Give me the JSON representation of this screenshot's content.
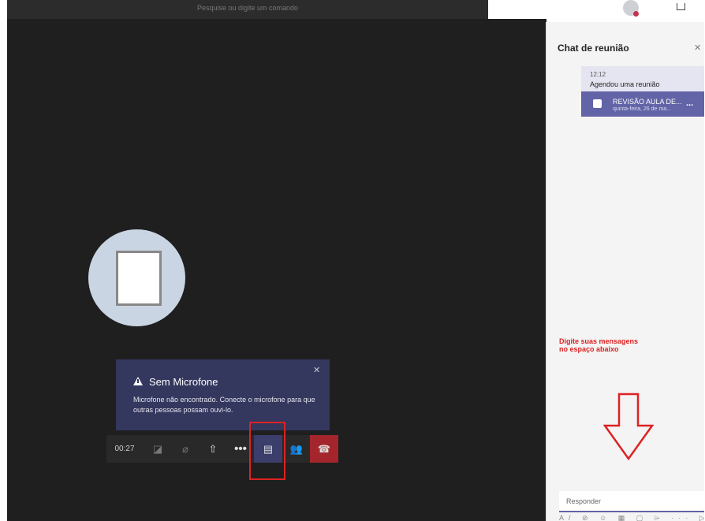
{
  "search": {
    "placeholder": "Pesquise ou digite um comando"
  },
  "toast": {
    "title": "Sem Microfone",
    "body": "Microfone não encontrado. Conecte o microfone para que outras pessoas possam ouvi-lo.",
    "close_glyph": "✕"
  },
  "callbar": {
    "timer": "00:27",
    "icons": [
      "video-off-icon",
      "mic-off-icon",
      "share-screen-icon",
      "more-icon",
      "chat-icon",
      "people-icon",
      "hangup-icon"
    ],
    "glyphs": {
      "camera": "◪",
      "mic": "⌀",
      "share": "⇧",
      "more": "•••",
      "chat": "▤",
      "people": "👥",
      "hangup": "☎"
    }
  },
  "panel": {
    "title": "Chat de reunião",
    "close_glyph": "✕",
    "message": {
      "time": "12:12",
      "text": "Agendou uma reunião",
      "card_title": "REVISÃO AULA DE...",
      "card_date": "quinta-feira, 26 de ma...",
      "more_glyph": "..."
    },
    "instruction_line1": "Digite suas mensagens",
    "instruction_line2": "no  espaço abaixo",
    "reply_placeholder": "Responder",
    "compose_tools": "A/ ⊘ ☺ ▦ ▢ ⌲ ··· ▷"
  },
  "colors": {
    "stage": "#1f1f1f",
    "toast": "#34375e",
    "accent": "#6264a7",
    "hangup": "#a4262c",
    "annotation": "#dd2222"
  }
}
